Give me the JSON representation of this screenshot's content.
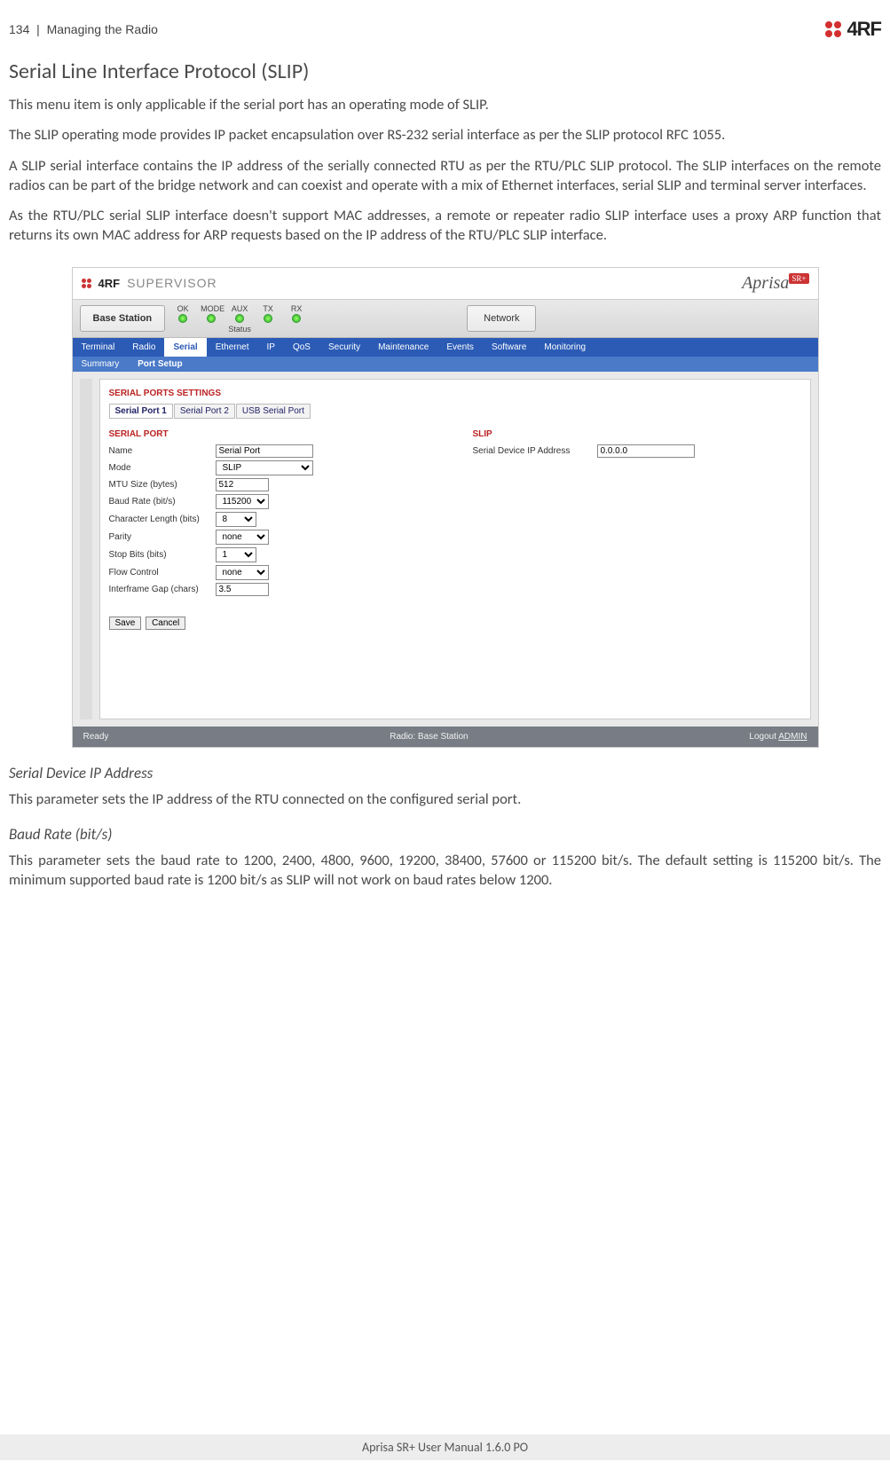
{
  "header": {
    "page_num": "134",
    "section": "Managing the Radio",
    "brand": "4RF"
  },
  "h1": "Serial Line Interface Protocol (SLIP)",
  "para1": "This menu item is only applicable if the serial port has an operating mode of SLIP.",
  "para2": "The SLIP operating mode provides IP packet encapsulation over RS-232 serial interface as per the SLIP protocol RFC 1055.",
  "para3": "A SLIP serial interface contains the IP address of the serially connected RTU as per the RTU/PLC SLIP protocol. The SLIP interfaces on the remote radios can be part of the bridge network and can coexist and operate with a mix of Ethernet interfaces, serial SLIP and terminal server interfaces.",
  "para4": "As the RTU/PLC serial SLIP interface doesn't support MAC addresses, a remote or repeater radio SLIP interface uses a proxy ARP function that returns its own MAC address for ARP requests based on the IP address of the RTU/PLC SLIP interface.",
  "supervisor": {
    "brand4rf": "4RF",
    "supervisor_label": "SUPERVISOR",
    "aprisa": "Aprisa",
    "sr": "SR+",
    "base_station": "Base Station",
    "led_labels": [
      "OK",
      "MODE",
      "AUX",
      "TX",
      "RX"
    ],
    "status_label": "Status",
    "network_btn": "Network",
    "nav": [
      "Terminal",
      "Radio",
      "Serial",
      "Ethernet",
      "IP",
      "QoS",
      "Security",
      "Maintenance",
      "Events",
      "Software",
      "Monitoring"
    ],
    "subnav": {
      "summary": "Summary",
      "port_setup": "Port Setup"
    },
    "panel": {
      "heading": "SERIAL PORTS SETTINGS",
      "tabs": [
        "Serial Port 1",
        "Serial Port 2",
        "USB Serial Port"
      ],
      "serial_port_head": "SERIAL PORT",
      "slip_head": "SLIP",
      "fields": {
        "name_label": "Name",
        "name_value": "Serial Port",
        "mode_label": "Mode",
        "mode_value": "SLIP",
        "mtu_label": "MTU Size (bytes)",
        "mtu_value": "512",
        "baud_label": "Baud Rate (bit/s)",
        "baud_value": "115200",
        "chlen_label": "Character Length (bits)",
        "chlen_value": "8",
        "parity_label": "Parity",
        "parity_value": "none",
        "stop_label": "Stop Bits (bits)",
        "stop_value": "1",
        "flow_label": "Flow Control",
        "flow_value": "none",
        "gap_label": "Interframe Gap (chars)",
        "gap_value": "3.5",
        "serdev_label": "Serial Device IP Address",
        "serdev_value": "0.0.0.0"
      },
      "save": "Save",
      "cancel": "Cancel"
    },
    "footer": {
      "ready": "Ready",
      "radio": "Radio: Base Station",
      "logout_label": "Logout",
      "logout_user": "ADMIN"
    }
  },
  "sub1_head": "Serial Device IP Address",
  "sub1_body": "This parameter sets the IP address of the RTU connected on the configured serial port.",
  "sub2_head": "Baud Rate (bit/s)",
  "sub2_body": "This parameter sets the baud rate to 1200, 2400, 4800, 9600, 19200, 38400, 57600 or 115200 bit/s. The default setting is 115200 bit/s. The minimum supported baud rate is 1200 bit/s as SLIP will not work on baud rates below 1200.",
  "footer_text": "Aprisa SR+ User Manual 1.6.0 PO"
}
